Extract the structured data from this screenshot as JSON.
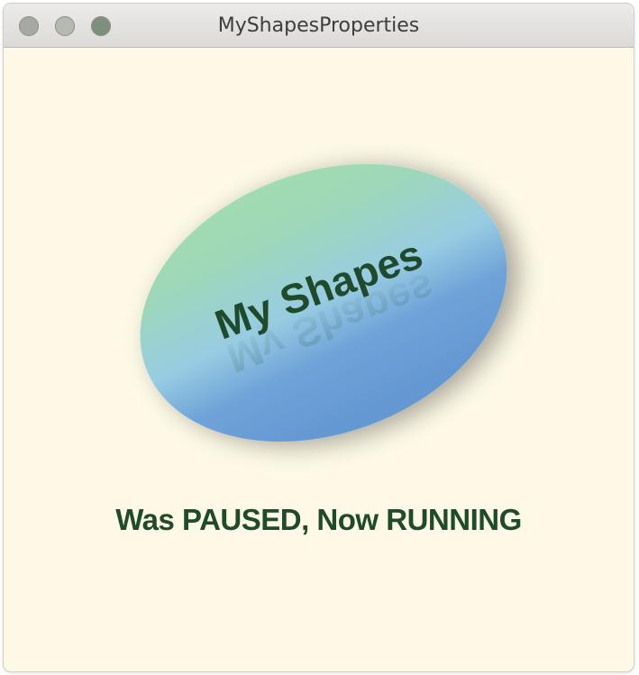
{
  "window": {
    "title": "MyShapesProperties"
  },
  "shape": {
    "label": "My Shapes",
    "reflection_label": "My Shapes",
    "text_color": "#1f4a2c",
    "gradient_colors": [
      "#a2dcb0",
      "#98cce2",
      "#6b9fd6"
    ]
  },
  "status": {
    "text": "Was PAUSED, Now RUNNING"
  },
  "icons": {
    "close": "traffic-light-close-icon",
    "minimize": "traffic-light-minimize-icon",
    "zoom": "traffic-light-zoom-icon"
  }
}
